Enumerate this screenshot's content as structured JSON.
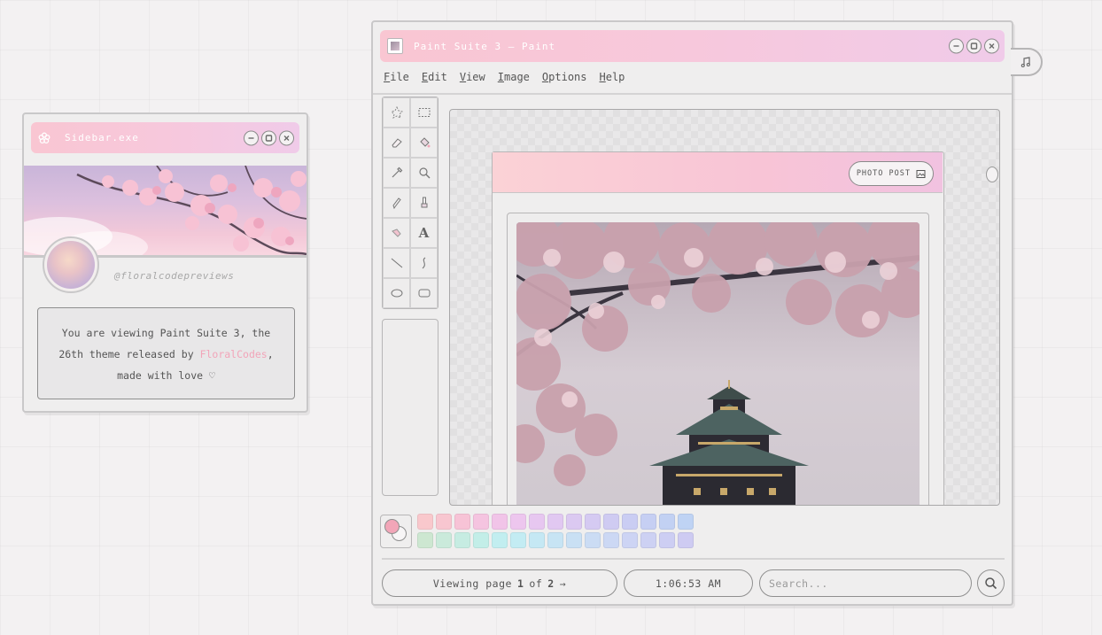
{
  "sidebar": {
    "title": "Sidebar.exe",
    "handle": "@floralcodepreviews",
    "about_pre": "You are viewing Paint Suite 3, the",
    "about_mid": "26th theme released by ",
    "about_link": "FloralCodes",
    "about_after": ",",
    "about_end": "made with love ♡"
  },
  "paint": {
    "title": "Paint Suite 3 – Paint",
    "menu": [
      {
        "key": "F",
        "rest": "ile"
      },
      {
        "key": "E",
        "rest": "dit"
      },
      {
        "key": "V",
        "rest": "iew"
      },
      {
        "key": "I",
        "rest": "mage"
      },
      {
        "key": "O",
        "rest": "ptions"
      },
      {
        "key": "H",
        "rest": "elp"
      }
    ],
    "tools": [
      "free-select-icon",
      "rect-select-icon",
      "eraser-icon",
      "fill-bucket-icon",
      "color-picker-icon",
      "magnifier-icon",
      "pencil-icon",
      "brush-icon",
      "airbrush-icon",
      "text-icon",
      "line-icon",
      "curve-icon",
      "ellipse-icon",
      "rounded-rect-icon"
    ],
    "text_tool_glyph": "A",
    "post_button_label": "PHOTO POST",
    "palette": {
      "foreground": "#f2a6b8",
      "background": "#f7f5f6",
      "row1": [
        "#f9c8cc",
        "#f8c6d0",
        "#f7c3d6",
        "#f5c4e0",
        "#f1c4e8",
        "#edc6ee",
        "#e7c7f0",
        "#e1c8f1",
        "#dbc9f1",
        "#d5caf2",
        "#cfcbf2",
        "#cacdf3",
        "#c6cff3",
        "#c2d1f3",
        "#bfd3f4"
      ],
      "row2": [
        "#cde7d1",
        "#caeadb",
        "#c6ece2",
        "#c3eee8",
        "#c2eef0",
        "#c3ecf3",
        "#c5e8f4",
        "#c7e4f4",
        "#c9e0f4",
        "#cbdcf4",
        "#ccd8f4",
        "#cdd4f4",
        "#cdd1f3",
        "#cdcef3",
        "#cecbf2"
      ]
    },
    "pager": {
      "prefix": "Viewing page",
      "current": "1",
      "sep": "of",
      "total": "2",
      "arrow": "→"
    },
    "clock": "1:06:53 AM",
    "search_placeholder": "Search..."
  }
}
